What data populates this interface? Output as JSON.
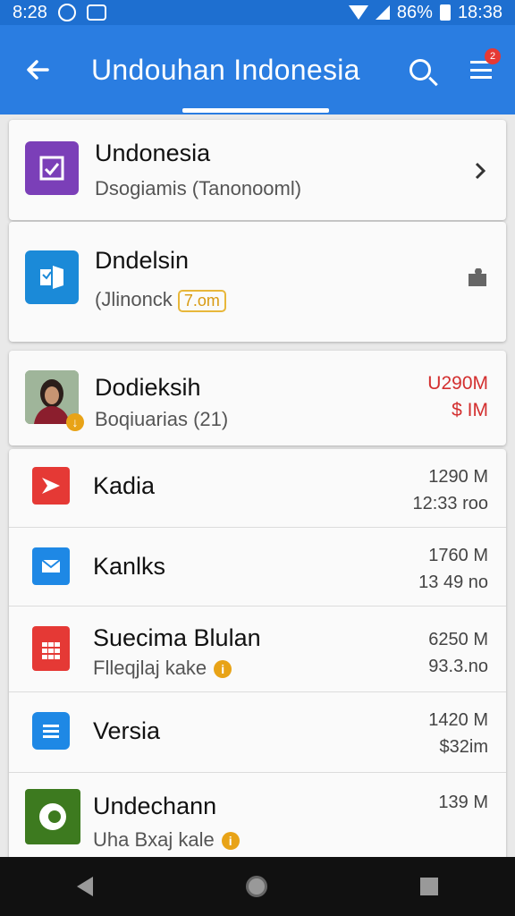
{
  "status_bar": {
    "time_left": "8:28",
    "battery_pct": "86%",
    "time_right": "18:38"
  },
  "app_bar": {
    "title": "Undouhan Indonesia",
    "menu_badge": "2"
  },
  "cards": [
    {
      "name": "Undonesia",
      "sub": "Dsogiamis (Tanonooml)"
    },
    {
      "name": "Dndelsin",
      "sub": "(Jlinonck",
      "size": "7.om"
    },
    {
      "name": "Dodieksih",
      "sub": "Boqiuarias (21)",
      "val1": "U290M",
      "val2": "$ IM"
    }
  ],
  "list": [
    {
      "name": "Kadia",
      "val1": "1290 M",
      "val2": "12:33 roo"
    },
    {
      "name": "Kanlks",
      "val1": "1760 M",
      "val2": "13 49 no"
    },
    {
      "name": "Suecima Blulan",
      "sub": "Flleqjlaj kake",
      "val1": "6250 M",
      "val2": "93.3.no"
    },
    {
      "name": "Versia",
      "val1": "1420 M",
      "val2": "$32im"
    },
    {
      "name": "Undechann",
      "sub": "Uha Bxaj kale",
      "val1": "139 M"
    }
  ]
}
